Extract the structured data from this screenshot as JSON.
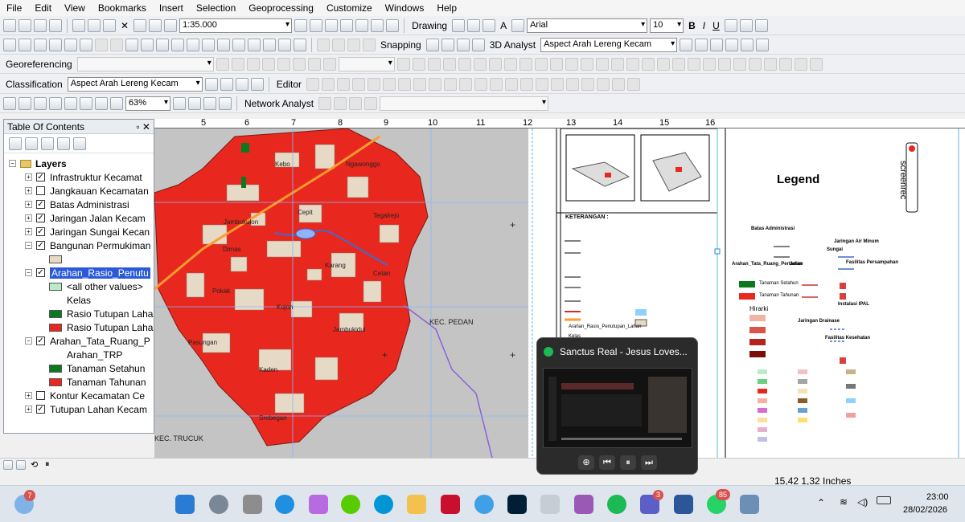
{
  "menu": [
    "File",
    "Edit",
    "View",
    "Bookmarks",
    "Insert",
    "Selection",
    "Geoprocessing",
    "Customize",
    "Windows",
    "Help"
  ],
  "standard_toolbar": {
    "scale": "1:35.000"
  },
  "drawing_toolbar": {
    "drawing_label": "Drawing",
    "font": "Arial",
    "font_size": "10",
    "bold": "B",
    "italic": "I",
    "underline": "U",
    "text_a": "A"
  },
  "tools_toolbar": {
    "snapping_label": "Snapping",
    "analyst_label": "3D Analyst",
    "layer_combo": "Aspect Arah Lereng Kecam"
  },
  "georef_toolbar": {
    "label": "Georeferencing"
  },
  "classification_toolbar": {
    "label": "Classification",
    "layer_combo": "Aspect Arah Lereng Kecam",
    "editor_label": "Editor"
  },
  "layout_toolbar": {
    "zoom": "63%",
    "network_label": "Network Analyst"
  },
  "toc": {
    "title": "Table Of Contents",
    "root": "Layers",
    "items": [
      {
        "label": "Infrastruktur Kecamat",
        "checked": true,
        "expander": "+"
      },
      {
        "label": "Jangkauan Kecamatan",
        "checked": false,
        "expander": "+"
      },
      {
        "label": "Batas Administrasi",
        "checked": true,
        "expander": "+"
      },
      {
        "label": "Jaringan Jalan Kecam",
        "checked": true,
        "expander": "+"
      },
      {
        "label": "Jaringan Sungai Kecan",
        "checked": true,
        "expander": "+"
      },
      {
        "label": "Bangunan Permukiman",
        "checked": true,
        "expander": "−"
      },
      {
        "label": "Arahan_Rasio_Penutu",
        "checked": true,
        "expander": "−"
      },
      {
        "label": "<all other values>"
      },
      {
        "label": "Kelas"
      },
      {
        "label": "Rasio Tutupan Laha"
      },
      {
        "label": "Rasio Tutupan Laha"
      },
      {
        "label": "Arahan_Tata_Ruang_P",
        "checked": true,
        "expander": "−"
      },
      {
        "label": "Arahan_TRP"
      },
      {
        "label": "Tanaman Setahun"
      },
      {
        "label": "Tanaman Tahunan"
      },
      {
        "label": "Kontur Kecamatan Ce",
        "checked": false,
        "expander": "+"
      },
      {
        "label": "Tutupan Lahan Kecam",
        "checked": true,
        "expander": "+"
      }
    ],
    "colors": {
      "bangunan": "#e6d9c6",
      "other": "#b9ecc6",
      "rasio1": "#0b7a1e",
      "rasio2": "#e8281e",
      "setahun": "#0b7a1e",
      "tahunan": "#e8281e"
    }
  },
  "ruler": [
    "5",
    "6",
    "7",
    "8",
    "9",
    "10",
    "11",
    "12",
    "13",
    "14",
    "15",
    "16"
  ],
  "map": {
    "places": [
      "Kebo",
      "Ngawonggo",
      "Jambukulon",
      "Cepit",
      "Tegalrejo",
      "Dimas",
      "Karang",
      "Cetan",
      "Pokak",
      "Kujon",
      "Jambukidul",
      "Pasungan",
      "Kaden",
      "Srebegan"
    ],
    "kec_pedan": "KEC. PEDAN",
    "kec_trucuk": "KEC. TRUCUK"
  },
  "layout": {
    "legend_title": "Legend",
    "keterangan": "KETERANGAN :",
    "batas_administrasi": "Batas Administrasi",
    "jaringan_air": "Jaringan Air Minum",
    "fasilitas": "Fasilitas Persampahan",
    "ipal": "Instalasi IPAL",
    "drainase": "Jaringan Drainase",
    "kesehatan": "Fasilitas Kesehatan",
    "tata_ruang": "Arahan_Tata_Ruang_Pertanian",
    "tanaman1": "Tanaman Setahun",
    "tanaman2": "Tanaman Tahunan",
    "hirarki": "Hirarki",
    "rasio_heading": "Arahan_Rasio_Penutupan_Lahan",
    "kelas": "Kelas",
    "sungai": "Sungai",
    "jalan": "Jalan",
    "screenrec": "screenrec"
  },
  "media_player": {
    "title": "Sanctus Real - Jesus Loves..."
  },
  "status": {
    "coords": "15,42  1,32 Inches"
  },
  "taskbar": {
    "time": "23:00",
    "date": "28/02/2026",
    "badge_weather": "7",
    "badge_teams": "3",
    "badge_whatsapp": "85"
  }
}
